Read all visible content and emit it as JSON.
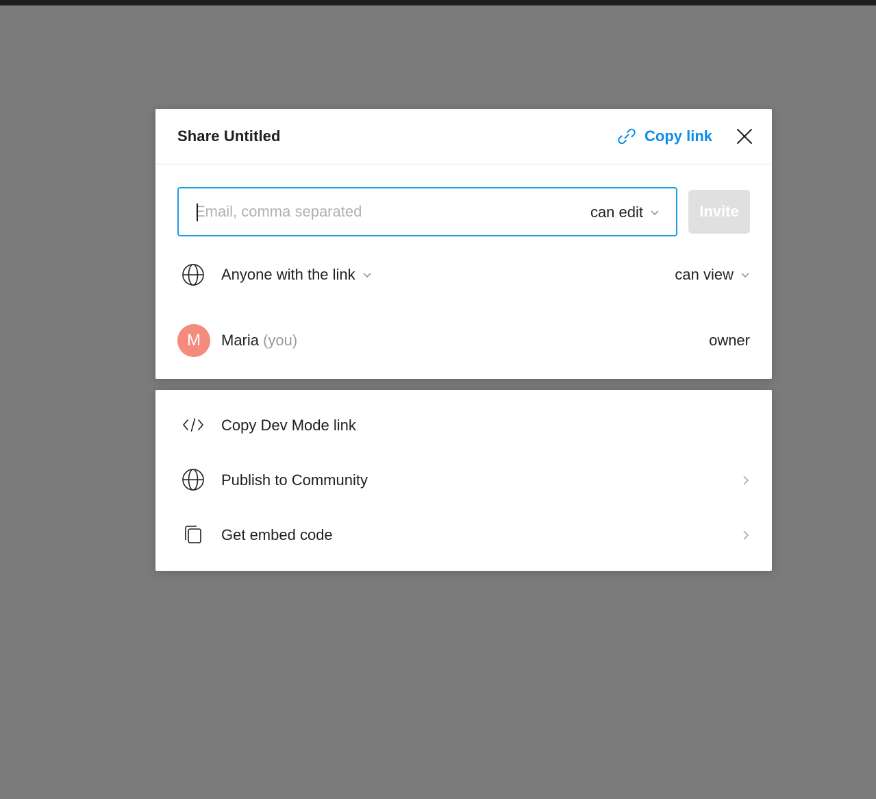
{
  "dialog": {
    "title": "Share Untitled",
    "copy_link_label": "Copy link",
    "close_icon": "close-icon",
    "accent_color": "#0d8ce9"
  },
  "invite": {
    "placeholder": "Email, comma separated",
    "value": "",
    "permission": "can edit",
    "button_label": "Invite"
  },
  "link_access": {
    "scope": "Anyone with the link",
    "permission": "can view",
    "icon": "globe-icon"
  },
  "members": [
    {
      "initial": "M",
      "name": "Maria",
      "note": "(you)",
      "role": "owner",
      "avatar_color": "#f58b7c"
    }
  ],
  "actions": [
    {
      "label": "Copy Dev Mode link",
      "icon": "code-icon"
    },
    {
      "label": "Publish to Community",
      "icon": "globe-icon"
    },
    {
      "label": "Get embed code",
      "icon": "embed-copy-icon"
    }
  ]
}
